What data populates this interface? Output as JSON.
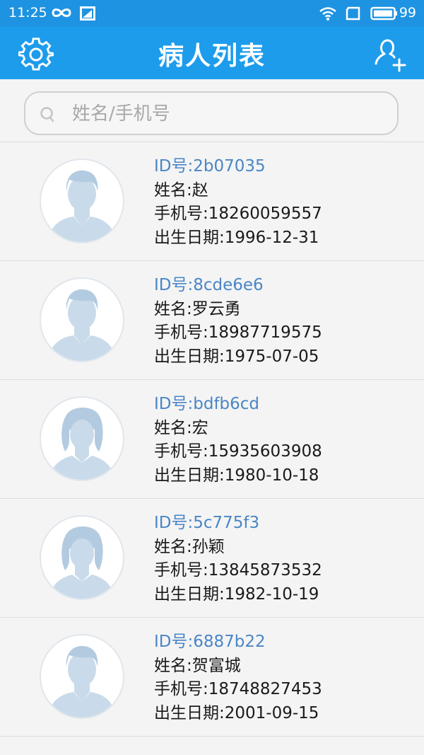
{
  "status_bar": {
    "time": "11:25",
    "battery": "99"
  },
  "app_bar": {
    "title": "病人列表",
    "settings_icon": "gear-icon",
    "add_icon": "add-user-icon"
  },
  "search": {
    "placeholder": "姓名/手机号",
    "value": ""
  },
  "patients": [
    {
      "id": "ID号:2b07035",
      "name": "姓名:赵",
      "phone": "手机号:18260059557",
      "birth": "出生日期:1996-12-31",
      "avatar": "male"
    },
    {
      "id": "ID号:8cde6e6",
      "name": "姓名:罗云勇",
      "phone": "手机号:18987719575",
      "birth": "出生日期:1975-07-05",
      "avatar": "male"
    },
    {
      "id": "ID号:bdfb6cd",
      "name": "姓名:宏",
      "phone": "手机号:15935603908",
      "birth": "出生日期:1980-10-18",
      "avatar": "female"
    },
    {
      "id": "ID号:5c775f3",
      "name": "姓名:孙颖",
      "phone": "手机号:13845873532",
      "birth": "出生日期:1982-10-19",
      "avatar": "female"
    },
    {
      "id": "ID号:6887b22",
      "name": "姓名:贺富城",
      "phone": "手机号:18748827453",
      "birth": "出生日期:2001-09-15",
      "avatar": "male"
    }
  ],
  "colors": {
    "status_bar": "#1e93e1",
    "app_bar": "#1d9cec",
    "id_text": "#4a86c5",
    "avatar_fill": "#c9dbea"
  }
}
